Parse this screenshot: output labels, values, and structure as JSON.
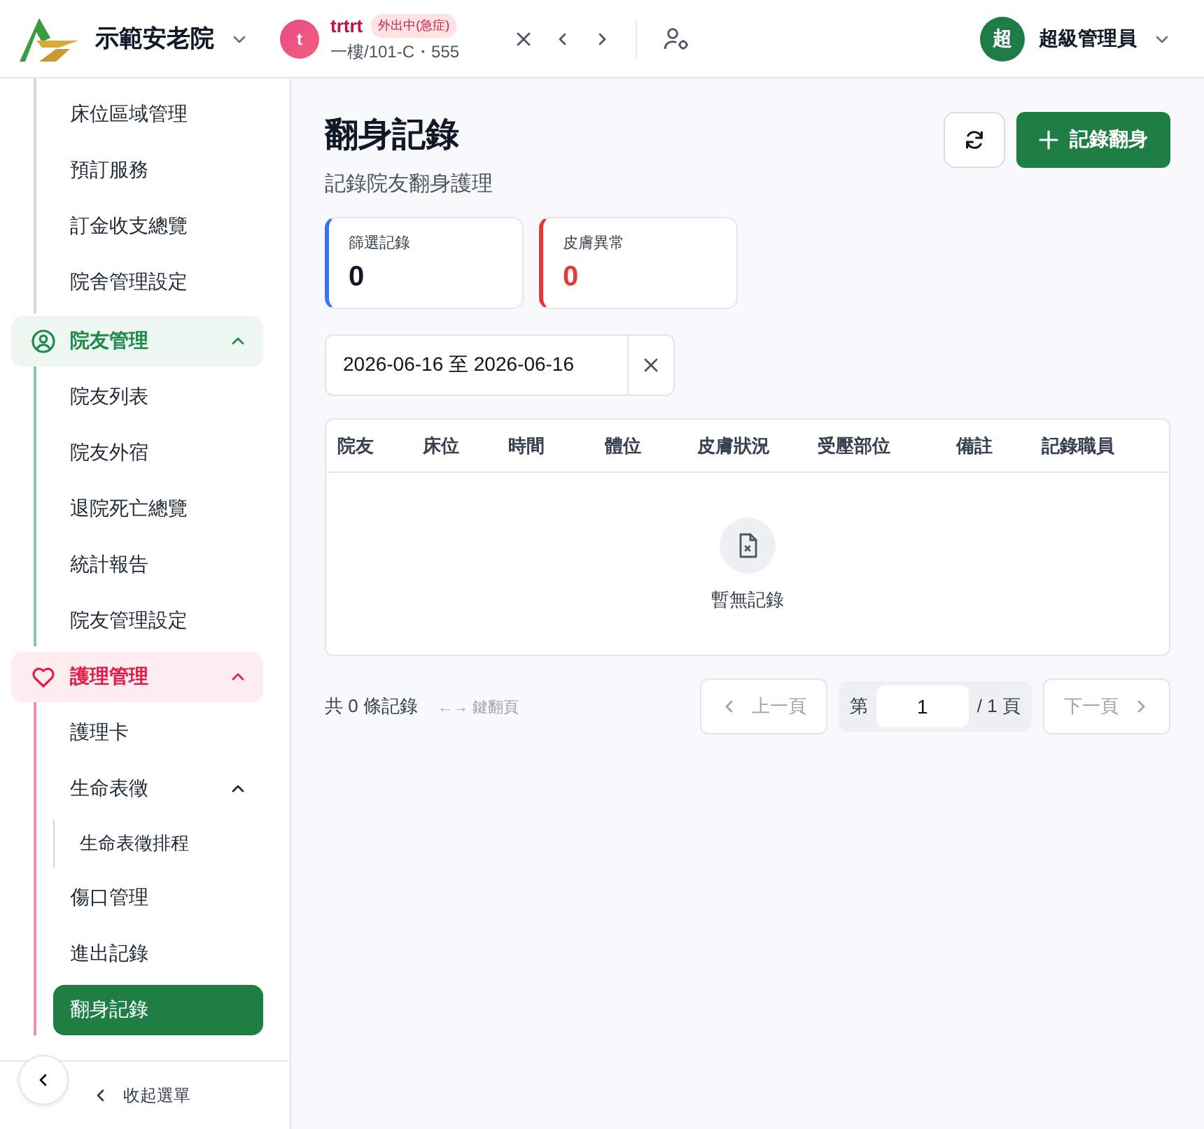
{
  "header": {
    "org_name": "示範安老院",
    "resident": {
      "avatar": "t",
      "name": "trtrt",
      "status": "外出中(急症)",
      "location": "一樓/101-C・555"
    },
    "user": {
      "avatar": "超",
      "name": "超級管理員"
    }
  },
  "sidebar": {
    "top_items": [
      {
        "label": "床位區域管理",
        "selected": false
      },
      {
        "label": "預訂服務",
        "selected": false
      },
      {
        "label": "訂金收支總覽",
        "selected": false
      },
      {
        "label": "院舍管理設定",
        "selected": false
      }
    ],
    "groups": [
      {
        "label": "院友管理",
        "kind": "person",
        "color": "#1e8a4c",
        "expanded": true,
        "items": [
          {
            "label": "院友列表",
            "selected": false
          },
          {
            "label": "院友外宿",
            "selected": false
          },
          {
            "label": "退院死亡總覽",
            "selected": false
          },
          {
            "label": "統計報告",
            "selected": false
          },
          {
            "label": "院友管理設定",
            "selected": false
          }
        ]
      },
      {
        "label": "護理管理",
        "kind": "heart",
        "color": "#e11d48",
        "expanded": true,
        "items": [
          {
            "label": "護理卡",
            "selected": false
          },
          {
            "label": "生命表徵",
            "selected": false,
            "expanded": true,
            "children": [
              {
                "label": "生命表徵排程",
                "selected": false
              }
            ]
          },
          {
            "label": "傷口管理",
            "selected": false
          },
          {
            "label": "進出記錄",
            "selected": false
          },
          {
            "label": "翻身記錄",
            "selected": true
          }
        ]
      }
    ],
    "collapse_label": "收起選單"
  },
  "page": {
    "title": "翻身記錄",
    "subtitle": "記錄院友翻身護理",
    "add_button": "記錄翻身",
    "stats": [
      {
        "label": "篩選記錄",
        "value": "0",
        "color": "#3b74f0"
      },
      {
        "label": "皮膚異常",
        "value": "0",
        "color": "#e53935"
      }
    ],
    "date_range": "2026-06-16 至 2026-06-16",
    "table": {
      "columns": [
        "院友",
        "床位",
        "時間",
        "體位",
        "皮膚狀況",
        "受壓部位",
        "備註",
        "記錄職員"
      ],
      "empty_text": "暫無記錄"
    },
    "pagination": {
      "total": "共 0 條記錄",
      "hint": "←→ 鍵翻頁",
      "prev": "上一頁",
      "prev_disabled": true,
      "page_prefix": "第",
      "page": "1",
      "page_suffix": "/ 1 頁",
      "next": "下一頁",
      "next_disabled": true
    }
  }
}
